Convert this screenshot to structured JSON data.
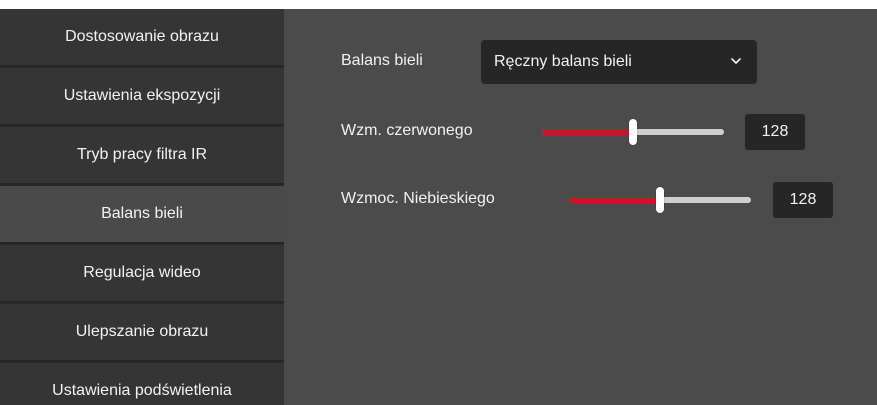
{
  "sidebar": {
    "items": [
      {
        "label": "Dostosowanie obrazu"
      },
      {
        "label": "Ustawienia ekspozycji"
      },
      {
        "label": "Tryb pracy filtra IR"
      },
      {
        "label": "Balans bieli"
      },
      {
        "label": "Regulacja wideo"
      },
      {
        "label": "Ulepszanie obrazu"
      },
      {
        "label": "Ustawienia podświetlenia"
      }
    ],
    "active": "Balans bieli"
  },
  "white_balance": {
    "label": "Balans bieli",
    "selected": "Ręczny balans bieli",
    "icon": "chevron-down-icon"
  },
  "red_gain": {
    "label": "Wzm. czerwonego",
    "value": "128",
    "fraction": 0.5
  },
  "blue_gain": {
    "label": "Wzmoc. Niebieskiego",
    "value": "128",
    "fraction": 0.5
  },
  "colors": {
    "accent": "#c8152a",
    "sidebar_bg": "#353535",
    "sidebar_active": "#4a4a4a",
    "content_bg": "#4b4b4b",
    "field_bg": "#262626"
  }
}
